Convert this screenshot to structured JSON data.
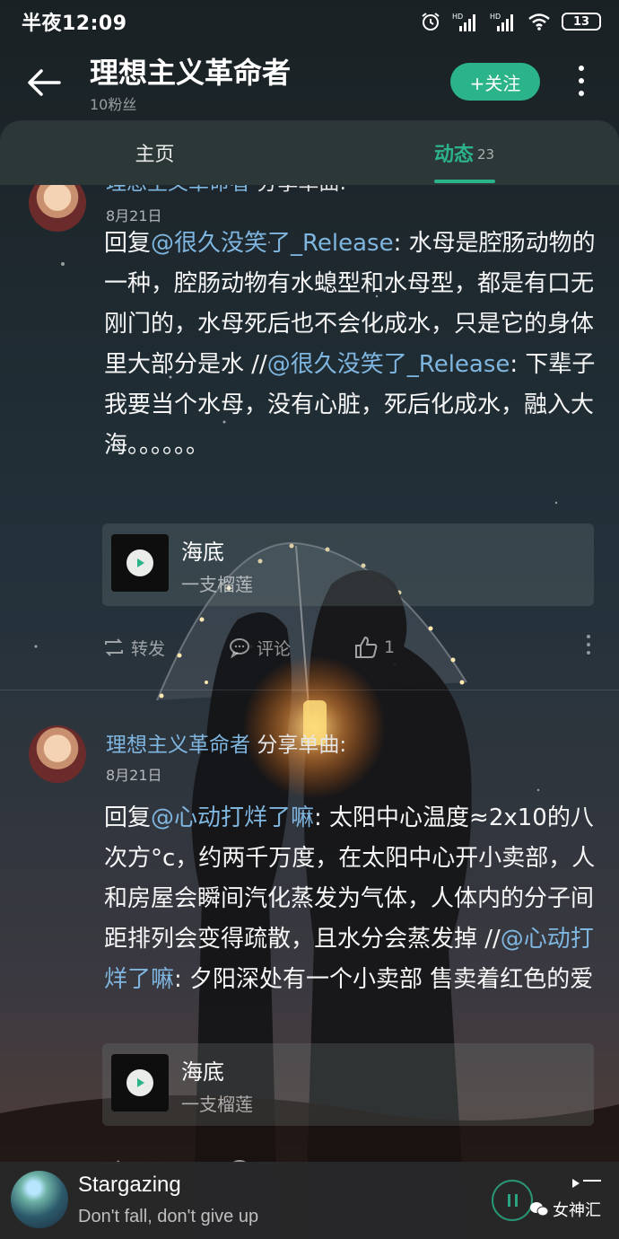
{
  "status_bar": {
    "time": "半夜12:09",
    "battery": "13"
  },
  "header": {
    "title": "理想主义革命者",
    "followers": "10粉丝",
    "follow_label": "+关注"
  },
  "tabs": [
    {
      "label": "主页",
      "count": ""
    },
    {
      "label": "动态",
      "count": "23"
    }
  ],
  "posts": [
    {
      "author": "理想主义革命者",
      "share_text": "分享单曲:",
      "date": "8月21日",
      "text_parts": {
        "p1": "回复",
        "m1": "@很久没笑了_Release",
        "p2": ": 水母是腔肠动物的一种，腔肠动物有水螅型和水母型，都是有口无刚门的，水母死后也不会化成水，只是它的身体里大部分是水 //",
        "m2": "@很久没笑了_Release",
        "p3": ": 下辈子我要当个水母，没有心脏，死后化成水，融入大海。。。。。。"
      },
      "song": {
        "title": "海底",
        "artist": "一支榴莲"
      },
      "actions": {
        "repost": "转发",
        "comment": "评论",
        "like": "1"
      }
    },
    {
      "author": "理想主义革命者",
      "share_text": "分享单曲:",
      "date": "8月21日",
      "text_parts": {
        "p1": "回复",
        "m1": "@心动打烊了嘛",
        "p2": ": 太阳中心温度≈2x10的八次方°c，约两千万度，在太阳中心开小卖部，人和房屋会瞬间汽化蒸发为气体，人体内的分子间距排列会变得疏散，且水分会蒸发掉 //",
        "m2": "@心动打烊了嘛",
        "p3": ": 夕阳深处有一个小卖部 售卖着红色的爱"
      },
      "song": {
        "title": "海底",
        "artist": "一支榴莲"
      },
      "actions": {
        "repost": "转发",
        "comment": "评论",
        "like": ""
      }
    }
  ],
  "player": {
    "title": "Stargazing",
    "subtitle": "Don't fall, don't give up",
    "watermark": "女神汇"
  },
  "colors": {
    "accent": "#2bb38a",
    "mention": "#7fb6e0"
  }
}
